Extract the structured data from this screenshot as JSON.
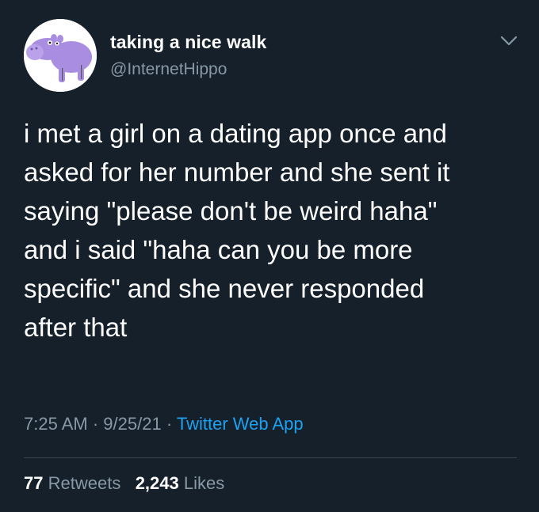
{
  "user": {
    "display_name": "taking a nice walk",
    "handle": "@InternetHippo",
    "avatar_icon": "purple-hippo-avatar"
  },
  "tweet": {
    "lines": [
      "i met a girl on a dating app once and",
      "asked for her number and she sent it",
      "saying \"please don't be weird haha\"",
      "and i said \"haha can you be more",
      "specific\" and she never responded",
      "after that"
    ]
  },
  "meta": {
    "time": "7:25 AM",
    "separator": "·",
    "date": "9/25/21",
    "source": "Twitter Web App"
  },
  "stats": {
    "retweets_count": "77",
    "retweets_label": "Retweets",
    "likes_count": "2,243",
    "likes_label": "Likes"
  },
  "colors": {
    "background": "#15202b",
    "secondary_text": "#8899a6",
    "link": "#1da1f2",
    "divider": "#38444d",
    "avatar_hippo": "#a88de0"
  },
  "icons": {
    "menu": "chevron-down-icon"
  }
}
